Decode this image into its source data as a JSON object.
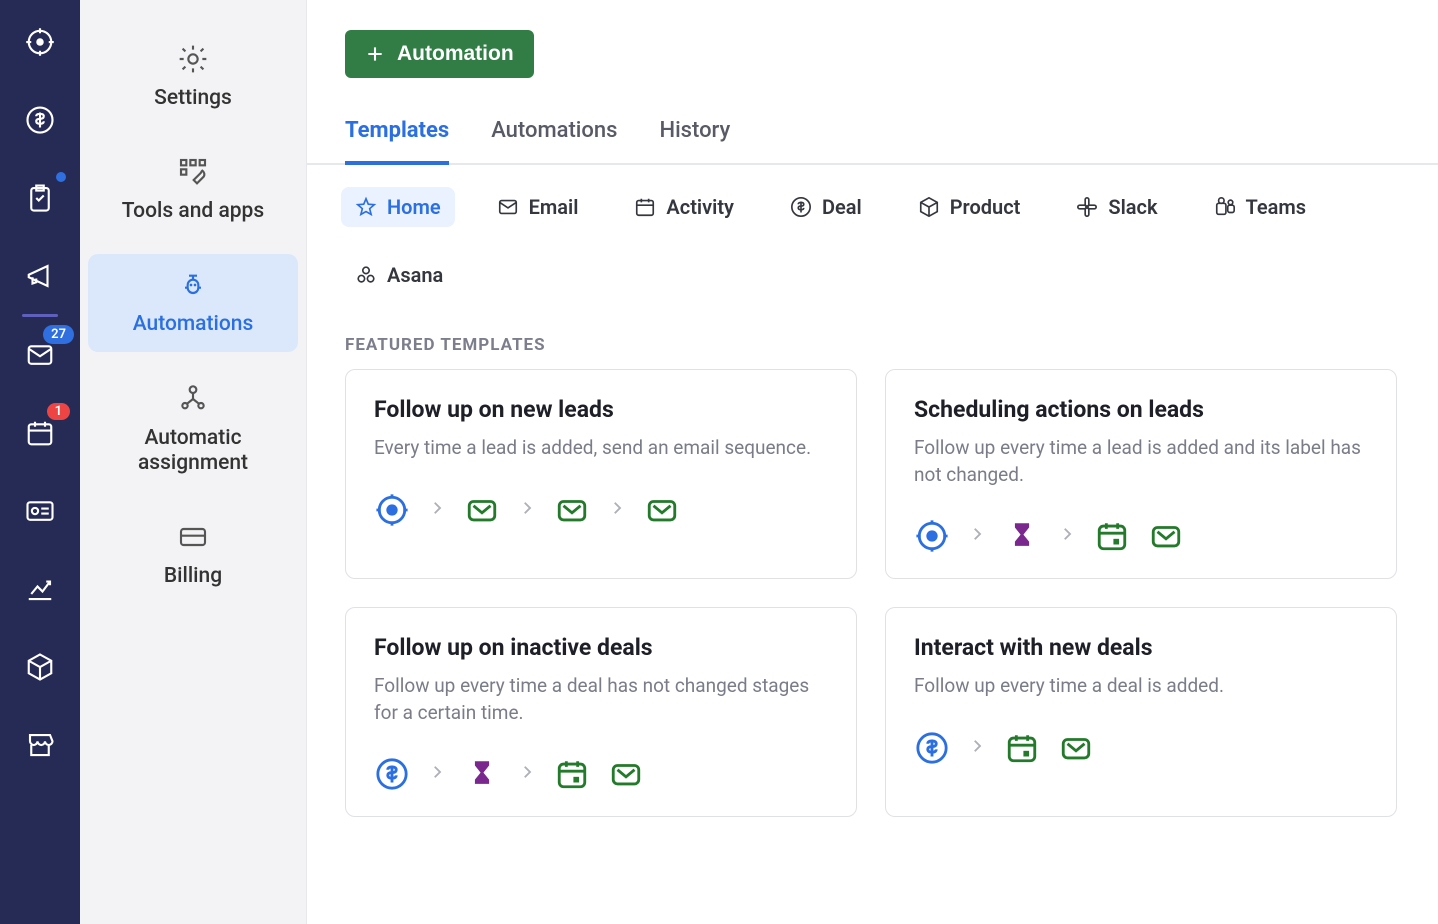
{
  "rail": {
    "badge_inbox": "27",
    "badge_calendar": "1"
  },
  "sidebar": {
    "items": [
      {
        "label": "Settings"
      },
      {
        "label": "Tools and apps"
      },
      {
        "label": "Automations"
      },
      {
        "label": "Automatic assignment"
      },
      {
        "label": "Billing"
      }
    ]
  },
  "header": {
    "new_automation_btn": "Automation"
  },
  "tabs": [
    {
      "label": "Templates"
    },
    {
      "label": "Automations"
    },
    {
      "label": "History"
    }
  ],
  "filters": [
    {
      "label": "Home"
    },
    {
      "label": "Email"
    },
    {
      "label": "Activity"
    },
    {
      "label": "Deal"
    },
    {
      "label": "Product"
    },
    {
      "label": "Slack"
    },
    {
      "label": "Teams"
    },
    {
      "label": "Asana"
    }
  ],
  "section_title": "FEATURED TEMPLATES",
  "templates": [
    {
      "title": "Follow up on new leads",
      "desc": "Every time a lead is added, send an email sequence."
    },
    {
      "title": "Scheduling actions on leads",
      "desc": "Follow up every time a lead is added and its label has not changed."
    },
    {
      "title": "Follow up on inactive deals",
      "desc": "Follow up every time a deal has not changed stages for a certain time."
    },
    {
      "title": "Interact with new deals",
      "desc": "Follow up every time a deal is added."
    }
  ]
}
